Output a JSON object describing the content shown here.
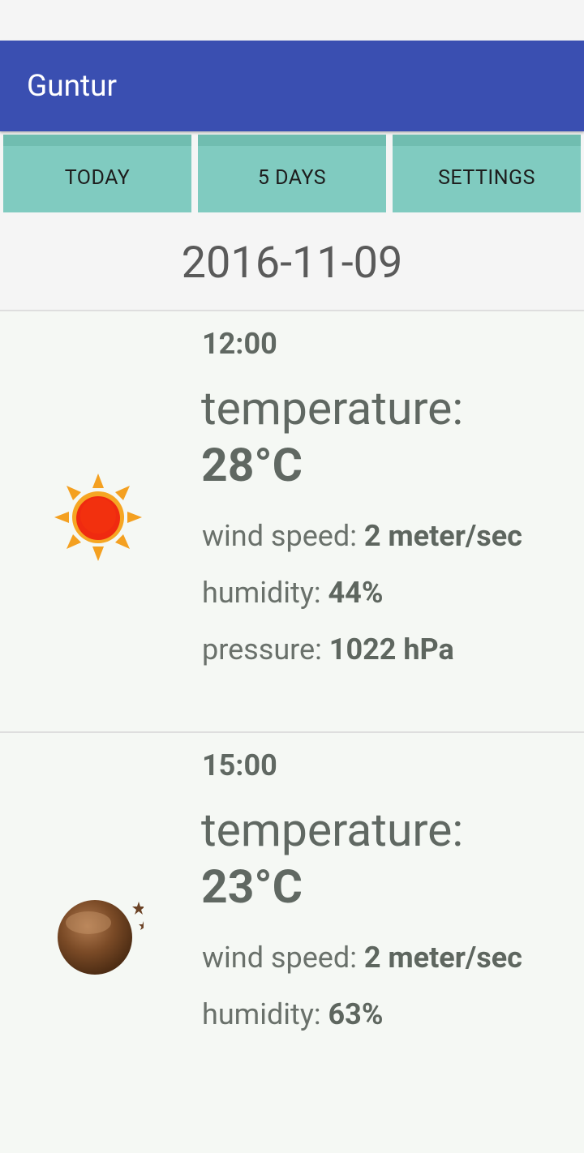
{
  "app": {
    "title": "Guntur"
  },
  "tabs": [
    {
      "label": "TODAY"
    },
    {
      "label": "5 DAYS"
    },
    {
      "label": "SETTINGS"
    }
  ],
  "date": "2016-11-09",
  "forecast": [
    {
      "time": "12:00",
      "icon": "sun-icon",
      "temperature_label": "temperature:",
      "temperature": "28°C",
      "wind_label": "wind speed:",
      "wind": "2 meter/sec",
      "humidity_label": "humidity:",
      "humidity": "44%",
      "pressure_label": "pressure:",
      "pressure": "1022 hPa"
    },
    {
      "time": "15:00",
      "icon": "moon-stars-icon",
      "temperature_label": "temperature:",
      "temperature": "23°C",
      "wind_label": "wind speed:",
      "wind": "2 meter/sec",
      "humidity_label": "humidity:",
      "humidity": "63%"
    }
  ],
  "colors": {
    "app_bar": "#3a4fb1",
    "tab_background": "#80cbc0",
    "text": "#606862"
  }
}
